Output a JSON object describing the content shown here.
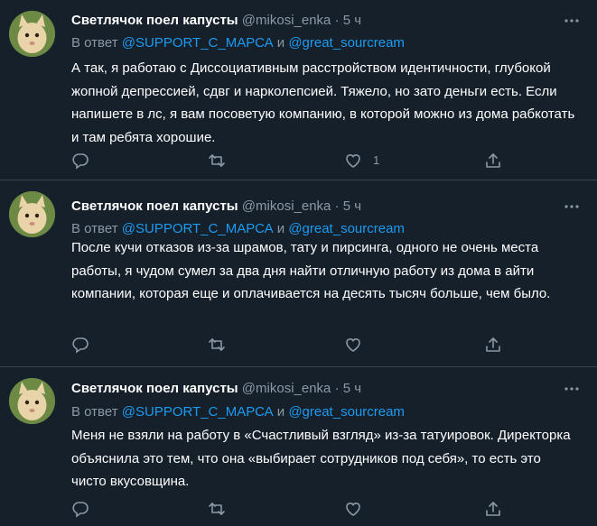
{
  "tweets": [
    {
      "author_name": "Светлячок поел капусты",
      "handle": "@mikosi_enka",
      "separator": "·",
      "time": "5 ч",
      "reply_prefix": "В ответ",
      "reply_mention_1": "@SUPPORT_С_МАРСА",
      "reply_and": "и",
      "reply_mention_2": "@great_sourcream",
      "text": "А так, я работаю с Диссоциативным расстройством идентичности, глубокой жопной депрессией, сдвг и нарколепсией. Тяжело, но зато деньги есть. Если напишете в лс, я вам посоветую компанию, в которой можно из дома рабкотать и там ребята хорошие.",
      "like_count": "1"
    },
    {
      "author_name": "Светлячок поел капусты",
      "handle": "@mikosi_enka",
      "separator": "·",
      "time": "5 ч",
      "reply_prefix": "В ответ",
      "reply_mention_1": "@SUPPORT_С_МАРСА",
      "reply_and": "и",
      "reply_mention_2": "@great_sourcream",
      "text": "После кучи отказов из-за шрамов, тату и пирсинга, одного не очень места работы, я чудом сумел за два дня найти отличную работу из дома в айти компании, которая еще и оплачивается на десять тысяч больше, чем было.",
      "like_count": ""
    },
    {
      "author_name": "Светлячок поел капусты",
      "handle": "@mikosi_enka",
      "separator": "·",
      "time": "5 ч",
      "reply_prefix": "В ответ",
      "reply_mention_1": "@SUPPORT_С_МАРСА",
      "reply_and": "и",
      "reply_mention_2": "@great_sourcream",
      "text": "Меня не взяли на работу в «Счастливый взгляд» из-за татуировок. Директорка объяснила это тем, что она «выбирает сотрудников под себя», то есть это чисто вкусовщина.",
      "like_count": ""
    }
  ],
  "icons": {
    "reply": "reply-icon",
    "retweet": "retweet-icon",
    "like": "like-icon",
    "share": "share-icon",
    "more": "more-icon"
  },
  "colors": {
    "background": "#15202b",
    "divider": "#38444d",
    "secondary_text": "#8b98a5",
    "mention": "#1d9bf0"
  }
}
